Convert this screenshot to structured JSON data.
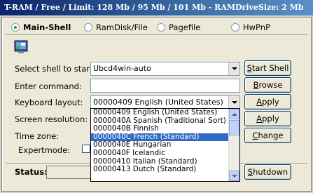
{
  "title": "T-RAM / Free / Limit: 128 Mb / 95 Mb / 101 Mb - RAMDriveSize:    2 Mb",
  "tabs": [
    {
      "label": "Main-Shell",
      "selected": true
    },
    {
      "label": "RamDisk/File",
      "selected": false
    },
    {
      "label": "Pagefile",
      "selected": false
    },
    {
      "label": "HwPnP",
      "selected": false
    }
  ],
  "form": {
    "shell_label": "Select shell to start:",
    "shell_value": "Ubcd4win-auto",
    "command_label": "Enter command:",
    "command_value": "",
    "keyboard_label": "Keyboard layout:",
    "keyboard_value": "00000409 English (United States)",
    "resolution_label": "Screen resolution:",
    "timezone_label": "Time zone:",
    "expert_label": "Expertmode:"
  },
  "buttons": {
    "start_shell": "Start Shell",
    "browse": "Browse",
    "apply1": "Apply",
    "apply2": "Apply",
    "change": "Change",
    "shutdown": "Shutdown"
  },
  "status": {
    "label": "Status:",
    "value": ""
  },
  "dropdown": {
    "items": [
      "00000409 English (United States)",
      "0000040A Spanish (Traditional Sort)",
      "0000040B Finnish",
      "0000040C French (Standard)",
      "0000040E Hungarian",
      "0000040F Icelandic",
      "00000410 Italian (Standard)",
      "00000413 Dutch (Standard)"
    ],
    "highlighted_index": 3
  },
  "colors": {
    "titlebar": "#0a246a",
    "highlight": "#316ac5",
    "radio_dot": "#21a121"
  }
}
